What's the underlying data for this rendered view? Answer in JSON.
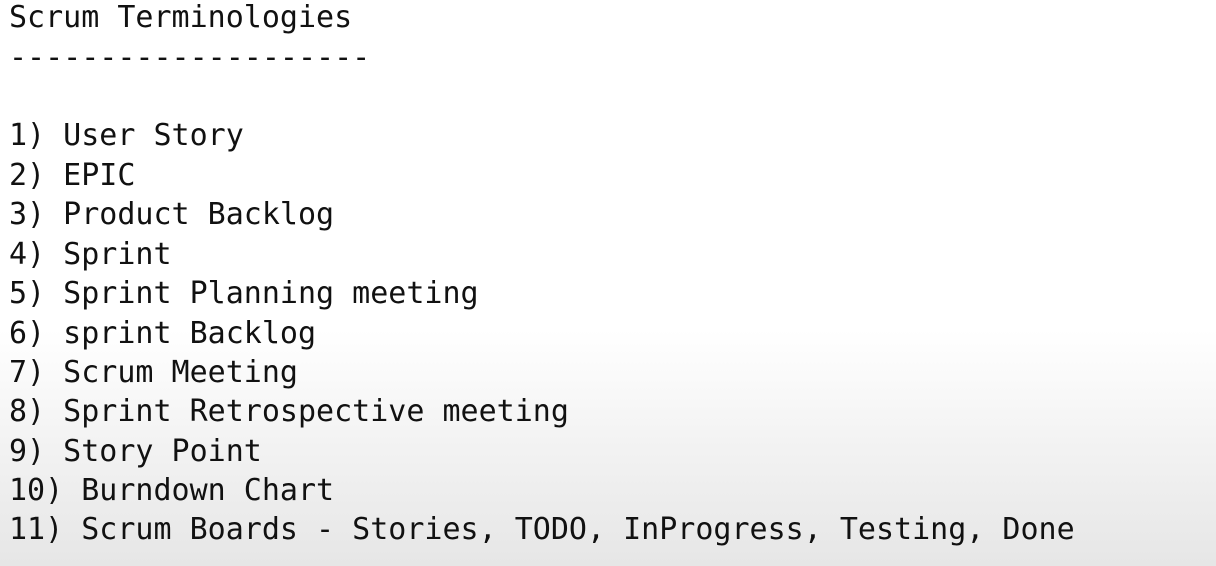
{
  "document": {
    "title": "Scrum Terminologies",
    "rule": "--------------------",
    "items": [
      "1) User Story",
      "2) EPIC",
      "3) Product Backlog",
      "4) Sprint",
      "5) Sprint Planning meeting",
      "6) sprint Backlog",
      "7) Scrum Meeting",
      "8) Sprint Retrospective meeting",
      "9) Story Point",
      "10) Burndown Chart",
      "11) Scrum Boards - Stories, TODO, InProgress, Testing, Done"
    ]
  }
}
